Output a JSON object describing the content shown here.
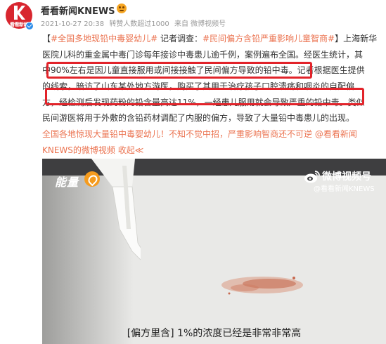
{
  "account": {
    "name": "看看新闻KNEWS",
    "avatar_text": "看看新闻",
    "meta": {
      "datetime": "2021-10-27 20:38",
      "reposts": "转赞人数超过1000",
      "source": "来自 微博视频号"
    }
  },
  "post": {
    "lines": [
      [
        {
          "t": "【",
          "c": "plain"
        },
        {
          "t": "#全国多地现铅中毒婴幼儿#",
          "c": "hash"
        },
        {
          "t": " 记者调查：",
          "c": "plain"
        },
        {
          "t": "#民间偏方含铅严重影响儿童智商#",
          "c": "hash"
        },
        {
          "t": "】上海新华",
          "c": "plain"
        }
      ],
      [
        {
          "t": "医院儿科的重金属中毒门诊每年接诊中毒患儿逾千例，案例遍布全国。经医生统计，其",
          "c": "plain"
        }
      ],
      [
        {
          "t": "中90%左右是因儿童直接服用或间接接触了民间偏方导致的铅中毒。记者根据医生提供",
          "c": "plain"
        }
      ],
      [
        {
          "t": "的线索，暗访了山东某处地方游医，购买了其用于治疗孩子口腔溃疡和咽炎的自配偏",
          "c": "plain"
        }
      ],
      [
        {
          "t": "方，经检测后发现药粉的铅含量高达11%，一经患儿服用就会导致严重的铅中毒。类似",
          "c": "plain"
        }
      ],
      [
        {
          "t": "民间游医将用于外敷的含铅药材调配了内服的偏方，导致了大量铅中毒患儿的出现。",
          "c": "plain"
        }
      ],
      [
        {
          "t": "全国各地惊现大量铅中毒婴幼儿！不知不觉中招，严重影响智商还不可逆",
          "c": "link"
        },
        {
          "t": " @看看新闻",
          "c": "link"
        }
      ],
      [
        {
          "t": "KNEWS的微博视频",
          "c": "link"
        },
        {
          "t": " 收起",
          "c": "link"
        },
        {
          "t": "≪",
          "c": "link"
        }
      ]
    ]
  },
  "video": {
    "brand_logo": "能量",
    "platform_label": "微博视频号",
    "watermark": "@看看新闻KNEWS",
    "subtitle": "[偏方里含] 1%的浓度已经是非常非常高"
  },
  "colors": {
    "brand_red": "#d8262f",
    "highlight_red": "#e2232a",
    "link_orange": "#eb7350",
    "verified_blue": "#2e8dea"
  }
}
